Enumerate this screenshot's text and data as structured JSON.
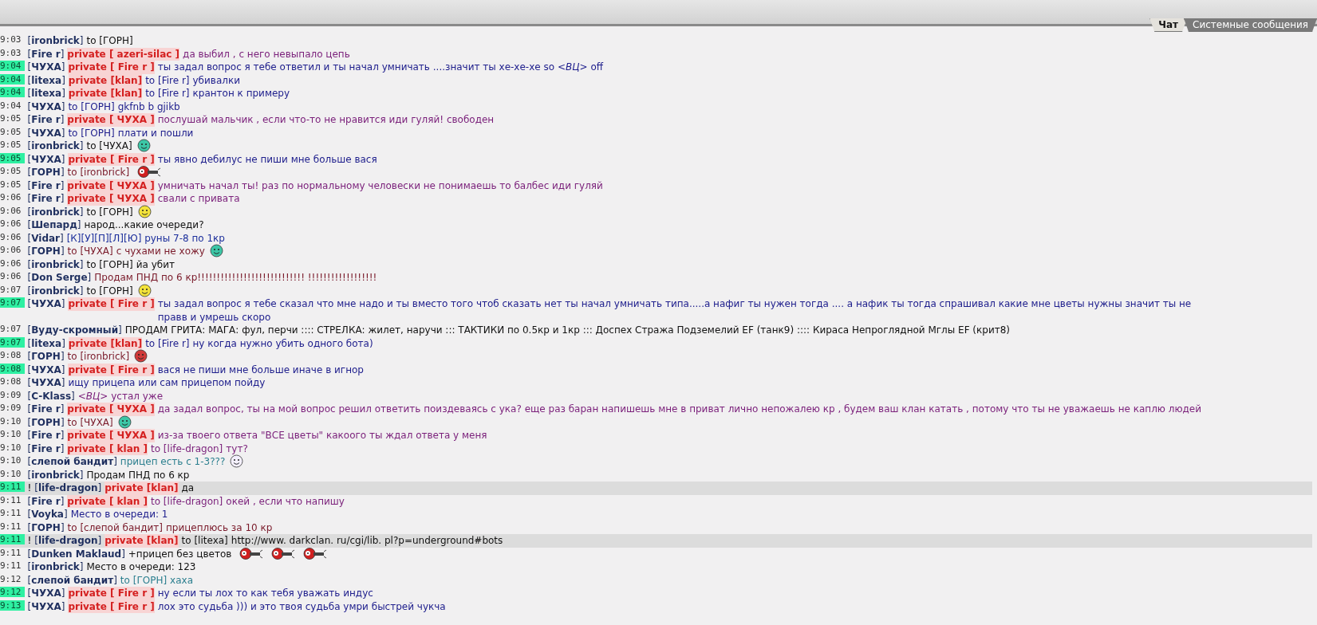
{
  "tabs": [
    {
      "label": "Чат",
      "selected": true
    },
    {
      "label": "Системные сообщения",
      "selected": false
    }
  ],
  "messages": [
    {
      "time": "9:03",
      "highlight": false,
      "sender": "[**ironbrick**]",
      "to": "to [ГОРН]",
      "color": "#111111"
    },
    {
      "time": "9:03",
      "highlight": false,
      "sender": "[**Fire r**]",
      "private": "private [ azeri-silac ]",
      "text": "да выбил , с него невыпало цепь",
      "color": "#7a1f7a"
    },
    {
      "time": "9:04",
      "highlight": true,
      "sender": "[**ЧУХА**]",
      "private": "private [ Fire r ]",
      "text": "ты задал вопрос я тебе ответил и ты начал умничать ....значит ты хе-хе-хе so *<ВЦ>* off",
      "color": "#1d1d8c"
    },
    {
      "time": "9:04",
      "highlight": true,
      "sender": "[**litexa**]",
      "private": "private [klan]",
      "to": "to [Fire r]",
      "text": "убивалки",
      "color": "#1d1d8c"
    },
    {
      "time": "9:04",
      "highlight": true,
      "sender": "[**litexa**]",
      "private": "private [klan]",
      "to": "to [Fire r]",
      "text": "крантон к примеру",
      "color": "#1d1d8c"
    },
    {
      "time": "9:04",
      "highlight": false,
      "sender": "[**ЧУХА**]",
      "to": "to [ГОРН]",
      "text": "gkfnb b gjikb",
      "color": "#1d1d8c"
    },
    {
      "time": "9:05",
      "highlight": false,
      "sender": "[**Fire r**]",
      "private": "private [ ЧУХА ]",
      "text": "послушай мальчик , если что-то не нравится иди гуляй! свободен",
      "color": "#7a1f7a"
    },
    {
      "time": "9:05",
      "highlight": false,
      "sender": "[**ЧУХА**]",
      "to": "to [ГОРН]",
      "text": "плати и пошли",
      "color": "#1d1d8c"
    },
    {
      "time": "9:05",
      "highlight": false,
      "sender": "[**ironbrick**]",
      "to": "to [ЧУХА]",
      "color": "#111111",
      "emoticons": [
        {
          "kind": "face",
          "color": "#3cc6a6"
        }
      ]
    },
    {
      "time": "9:05",
      "highlight": true,
      "sender": "[**ЧУХА**]",
      "private": "private [ Fire r ]",
      "text": "ты явно дебилус не пиши мне больше вася",
      "color": "#1d1d8c"
    },
    {
      "time": "9:05",
      "highlight": false,
      "sender": "[**ГОРН**]",
      "to": "to [ironbrick]",
      "color": "#7a1a2a",
      "emoticons": [
        {
          "kind": "gun",
          "color": "#d02020"
        }
      ]
    },
    {
      "time": "9:05",
      "highlight": false,
      "sender": "[**Fire r**]",
      "private": "private [ ЧУХА ]",
      "text": "умничать начал ты! раз по нормальному человески не понимаешь то балбес иди гуляй",
      "color": "#7a1f7a"
    },
    {
      "time": "9:06",
      "highlight": false,
      "sender": "[**Fire r**]",
      "private": "private [ ЧУХА ]",
      "text": "свали с привата",
      "color": "#7a1f7a"
    },
    {
      "time": "9:06",
      "highlight": false,
      "sender": "[**ironbrick**]",
      "to": "to [ГОРН]",
      "color": "#111111",
      "emoticons": [
        {
          "kind": "face",
          "color": "#f2e23a"
        }
      ]
    },
    {
      "time": "9:06",
      "highlight": false,
      "sender": "[**Шепард**]",
      "text": "народ...какие очереди?",
      "color": "#111111"
    },
    {
      "time": "9:06",
      "highlight": false,
      "sender": "[**Vidar**]",
      "text": "[К][У][П][Л][Ю] руны 7-8 по 1кр",
      "color": "#1d2f9c"
    },
    {
      "time": "9:06",
      "highlight": false,
      "sender": "[**ГОРН**]",
      "to": "to [ЧУХА]",
      "text": "с чухами не хожу",
      "color": "#7a1a2a",
      "emoticons": [
        {
          "kind": "face",
          "color": "#3cc6a6"
        }
      ]
    },
    {
      "time": "9:06",
      "highlight": false,
      "sender": "[**ironbrick**]",
      "to": "to [ГОРН]",
      "text": "йа убит",
      "color": "#111111"
    },
    {
      "time": "9:06",
      "highlight": false,
      "sender": "[**Don Serge**]",
      "text": "Продам ПНД по 6 кр!!!!!!!!!!!!!!!!!!!!!!!!!!!! !!!!!!!!!!!!!!!!!!",
      "color": "#7a1a2a"
    },
    {
      "time": "9:07",
      "highlight": false,
      "sender": "[**ironbrick**]",
      "to": "to [ГОРН]",
      "color": "#111111",
      "emoticons": [
        {
          "kind": "face",
          "color": "#f2e23a"
        }
      ]
    },
    {
      "time": "9:07",
      "highlight": true,
      "sender": "[**ЧУХА**]",
      "private": "private [ Fire r ]",
      "text": "ты задал вопрос я тебе сказал что мне надо и ты вместо того чтоб сказать нет ты начал умничать типа.....а нафиг ты нужен тогда .... а нафик ты тогда спрашивал какие мне цветы нужны значит ты не правв и умрешь скоро",
      "color": "#1d1d8c"
    },
    {
      "time": "9:07",
      "highlight": false,
      "sender": "[**Вуду-скромный**]",
      "text": "ПРОДАМ ГРИТА: МАГА: фул, перчи :::: СТРЕЛКА: жилет, наручи ::: ТАКТИКИ по 0.5кр и 1кр ::: Доспех Стража Подземелий EF (танк9) :::: Кираса Непроглядной Мглы EF (крит8)",
      "color": "#111111"
    },
    {
      "time": "9:07",
      "highlight": true,
      "sender": "[**litexa**]",
      "private": "private [klan]",
      "to": "to [Fire r]",
      "text": "ну когда нужно убить одного бота)",
      "color": "#1d1d8c"
    },
    {
      "time": "9:08",
      "highlight": false,
      "sender": "[**ГОРН**]",
      "to": "to [ironbrick]",
      "color": "#7a1a2a",
      "emoticons": [
        {
          "kind": "face",
          "color": "#d03a3a"
        }
      ]
    },
    {
      "time": "9:08",
      "highlight": true,
      "sender": "[**ЧУХА**]",
      "private": "private [ Fire r ]",
      "text": "вася не пиши мне больше иначе в игнор",
      "color": "#1d1d8c"
    },
    {
      "time": "9:08",
      "highlight": false,
      "sender": "[**ЧУХА**]",
      "text": "ищу прицепа или сам прицепом пойду",
      "color": "#1d1d8c"
    },
    {
      "time": "9:09",
      "highlight": false,
      "sender": "[**C-Klass**]",
      "text": "*<ВЦ>* устал уже",
      "color": "#7a1f7a"
    },
    {
      "time": "9:09",
      "highlight": false,
      "sender": "[**Fire r**]",
      "private": "private [ ЧУХА ]",
      "text": "да задал вопрос, ты на мой вопрос решил ответить поиздеваясь с ука? еще раз баран напишешь мне в приват лично непожалею кр , будем ваш клан катать , потому что ты не уважаешь не каплю людей",
      "color": "#7a1f7a"
    },
    {
      "time": "9:10",
      "highlight": false,
      "sender": "[**ГОРН**]",
      "to": "to [ЧУХА]",
      "color": "#7a1a2a",
      "emoticons": [
        {
          "kind": "face",
          "color": "#3cc6a6"
        }
      ]
    },
    {
      "time": "9:10",
      "highlight": false,
      "sender": "[**Fire r**]",
      "private": "private [ ЧУХА ]",
      "text": "из-за твоего ответа \"ВСЕ цветы\" какоого ты ждал ответа у меня",
      "color": "#7a1f7a"
    },
    {
      "time": "9:10",
      "highlight": false,
      "sender": "[**Fire r**]",
      "private": "private [ klan ]",
      "to": "to [life-dragon]",
      "text": "тут?",
      "color": "#7a1f7a"
    },
    {
      "time": "9:10",
      "highlight": false,
      "sender": "[**слепой бандит**]",
      "text": "прицеп есть с 1-3???",
      "color": "#2c7f8f",
      "emoticons": [
        {
          "kind": "face",
          "color": "#f4f0ff"
        }
      ]
    },
    {
      "time": "9:10",
      "highlight": false,
      "sender": "[**ironbrick**]",
      "text": "Продам ПНД по 6 кр",
      "color": "#111111"
    },
    {
      "time": "9:11",
      "highlight": true,
      "prefix": "!",
      "marked": true,
      "sender": "[**life-dragon**]",
      "private": "private [klan]",
      "text": "да",
      "color": "#111111"
    },
    {
      "time": "9:11",
      "highlight": false,
      "sender": "[**Fire r**]",
      "private": "private [ klan ]",
      "to": "to [life-dragon]",
      "text": "окей , если что напишу",
      "color": "#7a1f7a"
    },
    {
      "time": "9:11",
      "highlight": false,
      "sender": "[**Voyka**]",
      "text": "Место в очереди: 1",
      "color": "#1d1d8c"
    },
    {
      "time": "9:11",
      "highlight": false,
      "sender": "[**ГОРН**]",
      "to": "to [слепой бандит]",
      "text": "прицеплюсь за 10 кр",
      "color": "#7a1a2a"
    },
    {
      "time": "9:11",
      "highlight": true,
      "prefix": "!",
      "marked": true,
      "sender": "[**life-dragon**]",
      "private": "private [klan]",
      "to": "to [litexa]",
      "text": "http://www. darkclan. ru/cgi/lib. pl?p=underground#bots",
      "color": "#111111"
    },
    {
      "time": "9:11",
      "highlight": false,
      "sender": "[**Dunken Maklaud**]",
      "text": "+прицеп без цветов",
      "color": "#111111",
      "emoticons": [
        {
          "kind": "gun",
          "color": "#d02020"
        },
        {
          "kind": "gun",
          "color": "#d02020"
        },
        {
          "kind": "gun",
          "color": "#d02020"
        }
      ]
    },
    {
      "time": "9:11",
      "highlight": false,
      "sender": "[**ironbrick**]",
      "text": "Место в очереди: 123",
      "color": "#111111"
    },
    {
      "time": "9:12",
      "highlight": false,
      "sender": "[**слепой бандит**]",
      "to": "to [ГОРН]",
      "text": "хаха",
      "color": "#2c7f8f"
    },
    {
      "time": "9:12",
      "highlight": true,
      "sender": "[**ЧУХА**]",
      "private": "private [ Fire r ]",
      "text": "ну если ты лох то как тебя уважать индус",
      "color": "#1d1d8c"
    },
    {
      "time": "9:13",
      "highlight": true,
      "sender": "[**ЧУХА**]",
      "private": "private [ Fire r ]",
      "text": "лох это судьба ))) и это твоя судьба умри быстрей чукча",
      "color": "#1d1d8c"
    }
  ]
}
